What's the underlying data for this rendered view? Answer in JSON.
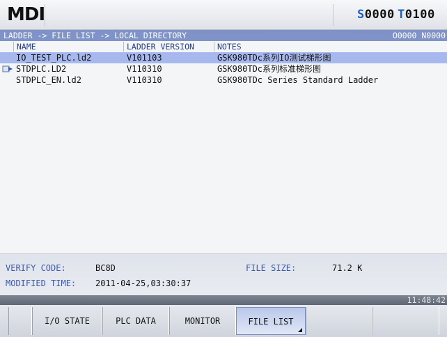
{
  "titlebar": {
    "mode": "MDI",
    "spindle_prefix": "S",
    "spindle_value": "0000",
    "tool_prefix": "T",
    "tool_value": "0100"
  },
  "pathbar": {
    "path": "LADDER -> FILE LIST -> LOCAL DIRECTORY",
    "program": "O0000 N0000"
  },
  "table": {
    "columns": [
      "NAME",
      "LADDER VERSION",
      "NOTES"
    ],
    "rows": [
      {
        "name": "IO_TEST_PLC.ld2",
        "version": "V101103",
        "notes": "GSK980TDc系列IO测试梯形图",
        "selected": true,
        "current": false
      },
      {
        "name": "STDPLC.LD2",
        "version": "V110310",
        "notes": "GSK980TDc系列标准梯形图",
        "selected": false,
        "current": true
      },
      {
        "name": "STDPLC_EN.ld2",
        "version": "V110310",
        "notes": "GSK980TDc Series Standard Ladder",
        "selected": false,
        "current": false
      }
    ]
  },
  "info": {
    "verify_label": "VERIFY CODE:",
    "verify_value": "BC8D",
    "size_label": "FILE SIZE:",
    "size_value": "71.2 K",
    "modified_label": "MODIFIED TIME:",
    "modified_value": "2011-04-25,03:30:37"
  },
  "status": {
    "clock": "11:48:42"
  },
  "softkeys": [
    "",
    "I/O STATE",
    "PLC DATA",
    "MONITOR",
    "FILE LIST",
    "",
    ""
  ],
  "colors": {
    "pathbar": "#7f93c9",
    "selection": "#a7b8ee",
    "label_blue": "#3e5aa8",
    "prefix_blue": "#1b5fbf"
  }
}
